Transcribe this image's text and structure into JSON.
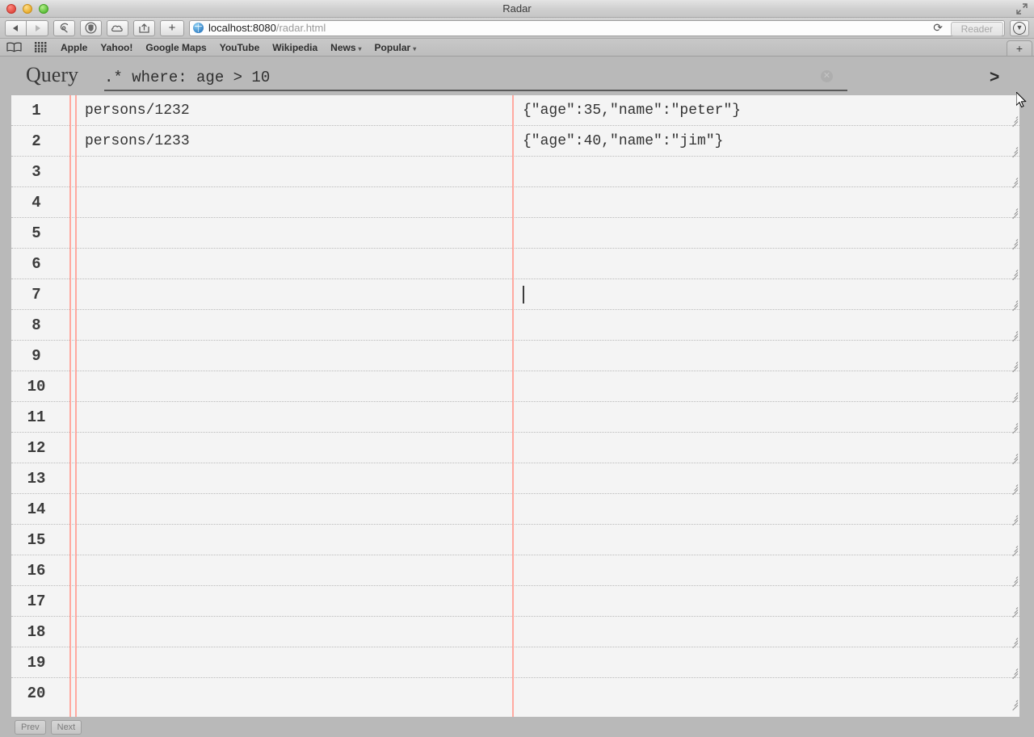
{
  "window": {
    "title": "Radar",
    "traffic_lights": [
      "close",
      "minimize",
      "zoom"
    ],
    "fullscreen_icon": "fullscreen-icon"
  },
  "toolbar": {
    "back_icon": "◀",
    "forward_icon": "▶",
    "safari_icon": "safari-compass-icon",
    "shield_icon": "shield-icon",
    "cloud_icon": "cloud-icon",
    "share_icon": "share-icon",
    "add_tab_label": "+",
    "url_host": "localhost:8080",
    "url_path": "/radar.html",
    "url_full": "localhost:8080/radar.html",
    "reload_icon": "⟳",
    "reader_label": "Reader",
    "downloads_icon": "⬇"
  },
  "bookmarks": {
    "book_icon": "book-icon",
    "grid_icon": "grid-icon",
    "items": [
      {
        "label": "Apple",
        "has_caret": false
      },
      {
        "label": "Yahoo!",
        "has_caret": false
      },
      {
        "label": "Google Maps",
        "has_caret": false
      },
      {
        "label": "YouTube",
        "has_caret": false
      },
      {
        "label": "Wikipedia",
        "has_caret": false
      },
      {
        "label": "News",
        "has_caret": true
      },
      {
        "label": "Popular",
        "has_caret": true
      }
    ],
    "caret_glyph": "▾",
    "new_tab_label": "+"
  },
  "query": {
    "label": "Query",
    "value": ".* where: age > 10",
    "placeholder": "",
    "clear_glyph": "✕",
    "submit_glyph": ">"
  },
  "grid": {
    "rule_color": "#ffa9a0",
    "rows": [
      {
        "num": "1",
        "key": "persons/1232",
        "value": "{\"age\":35,\"name\":\"peter\"}"
      },
      {
        "num": "2",
        "key": "persons/1233",
        "value": "{\"age\":40,\"name\":\"jim\"}"
      },
      {
        "num": "3",
        "key": "",
        "value": ""
      },
      {
        "num": "4",
        "key": "",
        "value": ""
      },
      {
        "num": "5",
        "key": "",
        "value": ""
      },
      {
        "num": "6",
        "key": "",
        "value": ""
      },
      {
        "num": "7",
        "key": "",
        "value": ""
      },
      {
        "num": "8",
        "key": "",
        "value": ""
      },
      {
        "num": "9",
        "key": "",
        "value": ""
      },
      {
        "num": "10",
        "key": "",
        "value": ""
      },
      {
        "num": "11",
        "key": "",
        "value": ""
      },
      {
        "num": "12",
        "key": "",
        "value": ""
      },
      {
        "num": "13",
        "key": "",
        "value": ""
      },
      {
        "num": "14",
        "key": "",
        "value": ""
      },
      {
        "num": "15",
        "key": "",
        "value": ""
      },
      {
        "num": "16",
        "key": "",
        "value": ""
      },
      {
        "num": "17",
        "key": "",
        "value": ""
      },
      {
        "num": "18",
        "key": "",
        "value": ""
      },
      {
        "num": "19",
        "key": "",
        "value": ""
      },
      {
        "num": "20",
        "key": "",
        "value": ""
      }
    ],
    "focused_row": 7
  },
  "footer": {
    "prev_label": "Prev",
    "next_label": "Next"
  }
}
